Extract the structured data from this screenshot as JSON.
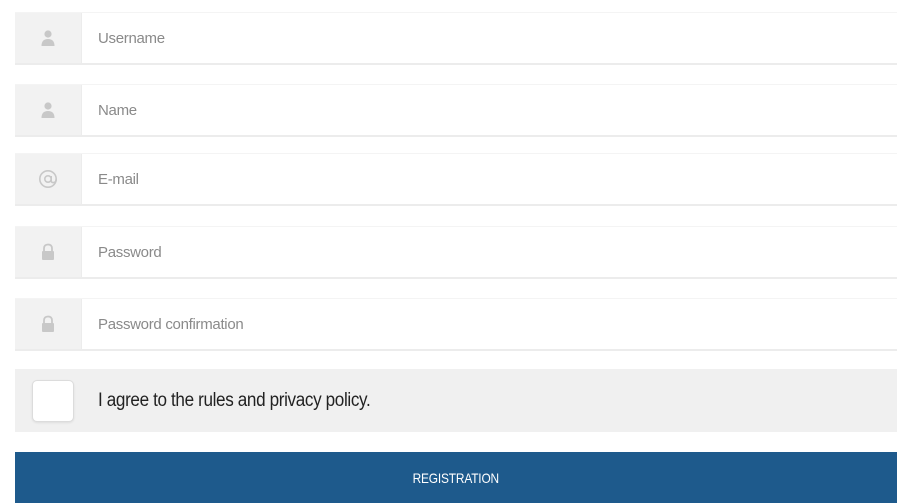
{
  "fields": [
    {
      "icon": "user-icon",
      "placeholder": "Username",
      "value": ""
    },
    {
      "icon": "user-icon",
      "placeholder": "Name",
      "value": ""
    },
    {
      "icon": "at-sign-icon",
      "placeholder": "E-mail",
      "value": ""
    },
    {
      "icon": "lock-icon",
      "placeholder": "Password",
      "value": ""
    },
    {
      "icon": "lock-icon",
      "placeholder": "Password confirmation",
      "value": ""
    }
  ],
  "agree": {
    "label": "I agree to the rules and privacy policy.",
    "checked": false
  },
  "submit": {
    "label": "REGISTRATION"
  },
  "colors": {
    "button_bg": "#1e5a8c",
    "icon_cell_bg": "#f2f2f2",
    "icon_color": "#c8c8c8",
    "agree_bg": "#f0f0f0"
  }
}
